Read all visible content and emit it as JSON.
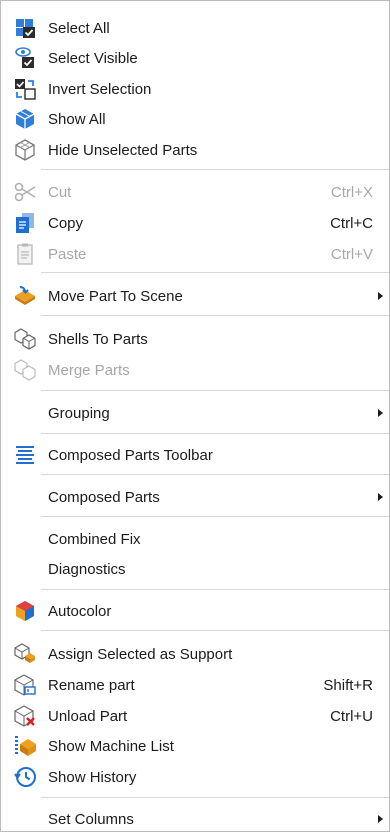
{
  "menu": {
    "select_all": {
      "label": "Select All",
      "icon": "select-all-icon"
    },
    "select_visible": {
      "label": "Select Visible",
      "icon": "select-visible-icon"
    },
    "invert_selection": {
      "label": "Invert Selection",
      "icon": "invert-selection-icon"
    },
    "show_all": {
      "label": "Show All",
      "icon": "show-all-icon"
    },
    "hide_unselected": {
      "label": "Hide Unselected Parts",
      "icon": "hide-unselected-icon"
    },
    "cut": {
      "label": "Cut",
      "shortcut": "Ctrl+X",
      "disabled": true,
      "icon": "scissors-icon"
    },
    "copy": {
      "label": "Copy",
      "shortcut": "Ctrl+C",
      "icon": "copy-icon"
    },
    "paste": {
      "label": "Paste",
      "shortcut": "Ctrl+V",
      "disabled": true,
      "icon": "paste-icon"
    },
    "move_part": {
      "label": "Move Part To Scene",
      "submenu": true,
      "icon": "move-part-icon"
    },
    "shells_to_parts": {
      "label": "Shells To Parts",
      "icon": "shells-icon"
    },
    "merge_parts": {
      "label": "Merge Parts",
      "disabled": true,
      "icon": "merge-parts-icon"
    },
    "grouping": {
      "label": "Grouping",
      "submenu": true
    },
    "composed_toolbar": {
      "label": "Composed Parts Toolbar",
      "icon": "toolbar-lines-icon"
    },
    "composed_parts": {
      "label": "Composed Parts",
      "submenu": true
    },
    "combined_fix": {
      "label": "Combined Fix"
    },
    "diagnostics": {
      "label": "Diagnostics"
    },
    "autocolor": {
      "label": "Autocolor",
      "icon": "autocolor-icon"
    },
    "assign_support": {
      "label": "Assign Selected as Support",
      "icon": "assign-support-icon"
    },
    "rename_part": {
      "label": "Rename part",
      "shortcut": "Shift+R",
      "icon": "rename-part-icon"
    },
    "unload_part": {
      "label": "Unload Part",
      "shortcut": "Ctrl+U",
      "icon": "unload-part-icon"
    },
    "machine_list": {
      "label": "Show Machine List",
      "icon": "machine-list-icon"
    },
    "history": {
      "label": "Show History",
      "icon": "history-icon"
    },
    "set_columns": {
      "label": "Set Columns",
      "submenu": true
    }
  },
  "colors": {
    "accent_blue": "#1e6fd0",
    "orange": "#f0a020",
    "disabled": "#a7a7a7",
    "red": "#d92020"
  }
}
